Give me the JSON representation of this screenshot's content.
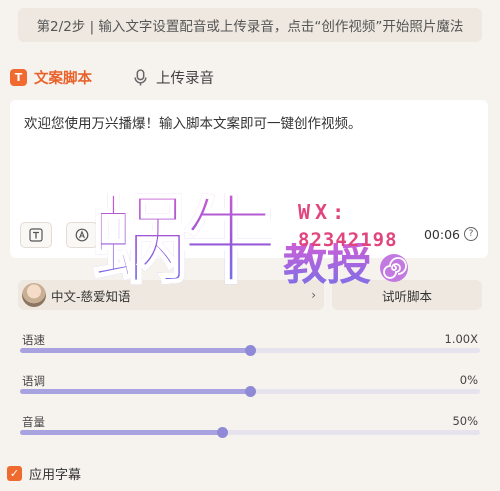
{
  "step_banner": "第2/2步 | 输入文字设置配音或上传录音，点击“创作视频”开始照片魔法",
  "tabs": [
    {
      "label": "文案脚本",
      "icon": "text-t-icon",
      "active": true
    },
    {
      "label": "上传录音",
      "icon": "microphone-icon",
      "active": false
    }
  ],
  "script": {
    "text": "欢迎您使用万兴播爆！输入脚本文案即可一键创作视频。",
    "duration": "00:06",
    "tools": [
      "text-format-icon",
      "ai-write-icon"
    ]
  },
  "voice": {
    "selected": "中文-慈爱知语",
    "listen_label": "试听脚本"
  },
  "sliders": [
    {
      "label": "语速",
      "value_text": "1.00X",
      "level": 0.5
    },
    {
      "label": "语调",
      "value_text": "0%",
      "level": 0.5
    },
    {
      "label": "音量",
      "value_text": "50%",
      "level": 0.44
    }
  ],
  "subtitle": {
    "label": "应用字幕",
    "checked": true
  },
  "watermark": {
    "big": "蜗牛",
    "small": "教授",
    "wx": "WX:",
    "number": "82342198"
  },
  "colors": {
    "accent": "#ef6a2e",
    "slider": "#a8a3e0",
    "watermark": "#e0457e"
  }
}
